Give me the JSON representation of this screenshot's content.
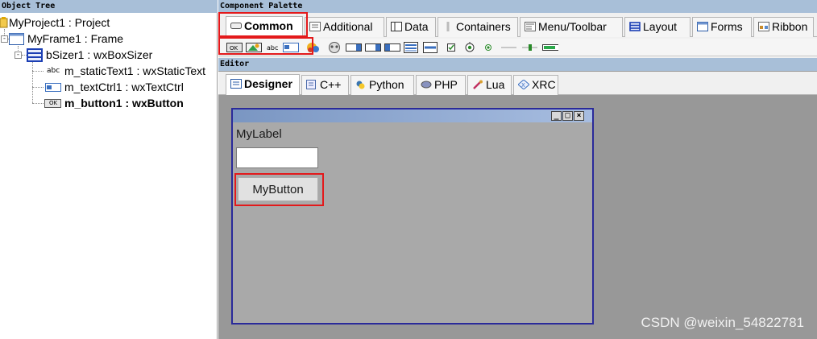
{
  "object_tree": {
    "header": "Object Tree",
    "items": [
      {
        "label": "MyProject1 : Project",
        "icon": "project-icon"
      },
      {
        "label": "MyFrame1 : Frame",
        "icon": "frame-icon"
      },
      {
        "label": "bSizer1 : wxBoxSizer",
        "icon": "boxsizer-icon"
      },
      {
        "label": "m_staticText1 : wxStaticText",
        "icon": "static-text-icon",
        "icon_text": "abc"
      },
      {
        "label": "m_textCtrl1 : wxTextCtrl",
        "icon": "text-ctrl-icon"
      },
      {
        "label": "m_button1 : wxButton",
        "icon": "button-icon",
        "icon_text": "OK"
      }
    ],
    "selected": "m_button1 : wxButton"
  },
  "palette": {
    "header": "Component Palette",
    "tabs": [
      "Common",
      "Additional",
      "Data",
      "Containers",
      "Menu/Toolbar",
      "Layout",
      "Forms",
      "Ribbon"
    ],
    "active_tab": "Common",
    "tools": [
      "button-tool-icon",
      "bitmap-button-tool-icon",
      "static-text-tool-icon",
      "text-ctrl-tool-icon",
      "static-bitmap-tool-icon",
      "combo-box-tool-icon",
      "choice-tool-icon",
      "list-box-tool-icon",
      "list-ctrl-tool-icon",
      "radio-box-tool-icon",
      "static-line-tool-icon",
      "check-box-tool-icon",
      "radio-button-tool-icon",
      "slider-tool-icon",
      "gauge-tool-icon"
    ],
    "tool_texts": {
      "button": "OK",
      "static_text": "abc"
    }
  },
  "editor": {
    "header": "Editor",
    "tabs": [
      "Designer",
      "C++",
      "Python",
      "PHP",
      "Lua",
      "XRC"
    ],
    "active_tab": "Designer",
    "frame": {
      "label_text": "MyLabel",
      "text_value": "",
      "button_label": "MyButton",
      "window_buttons": [
        "_",
        "□",
        "×"
      ]
    }
  },
  "watermark": "CSDN @weixin_54822781",
  "colors": {
    "highlight": "#e3191b",
    "header_bg": "#a8bfd8",
    "frame_border": "#2a2a9a"
  }
}
